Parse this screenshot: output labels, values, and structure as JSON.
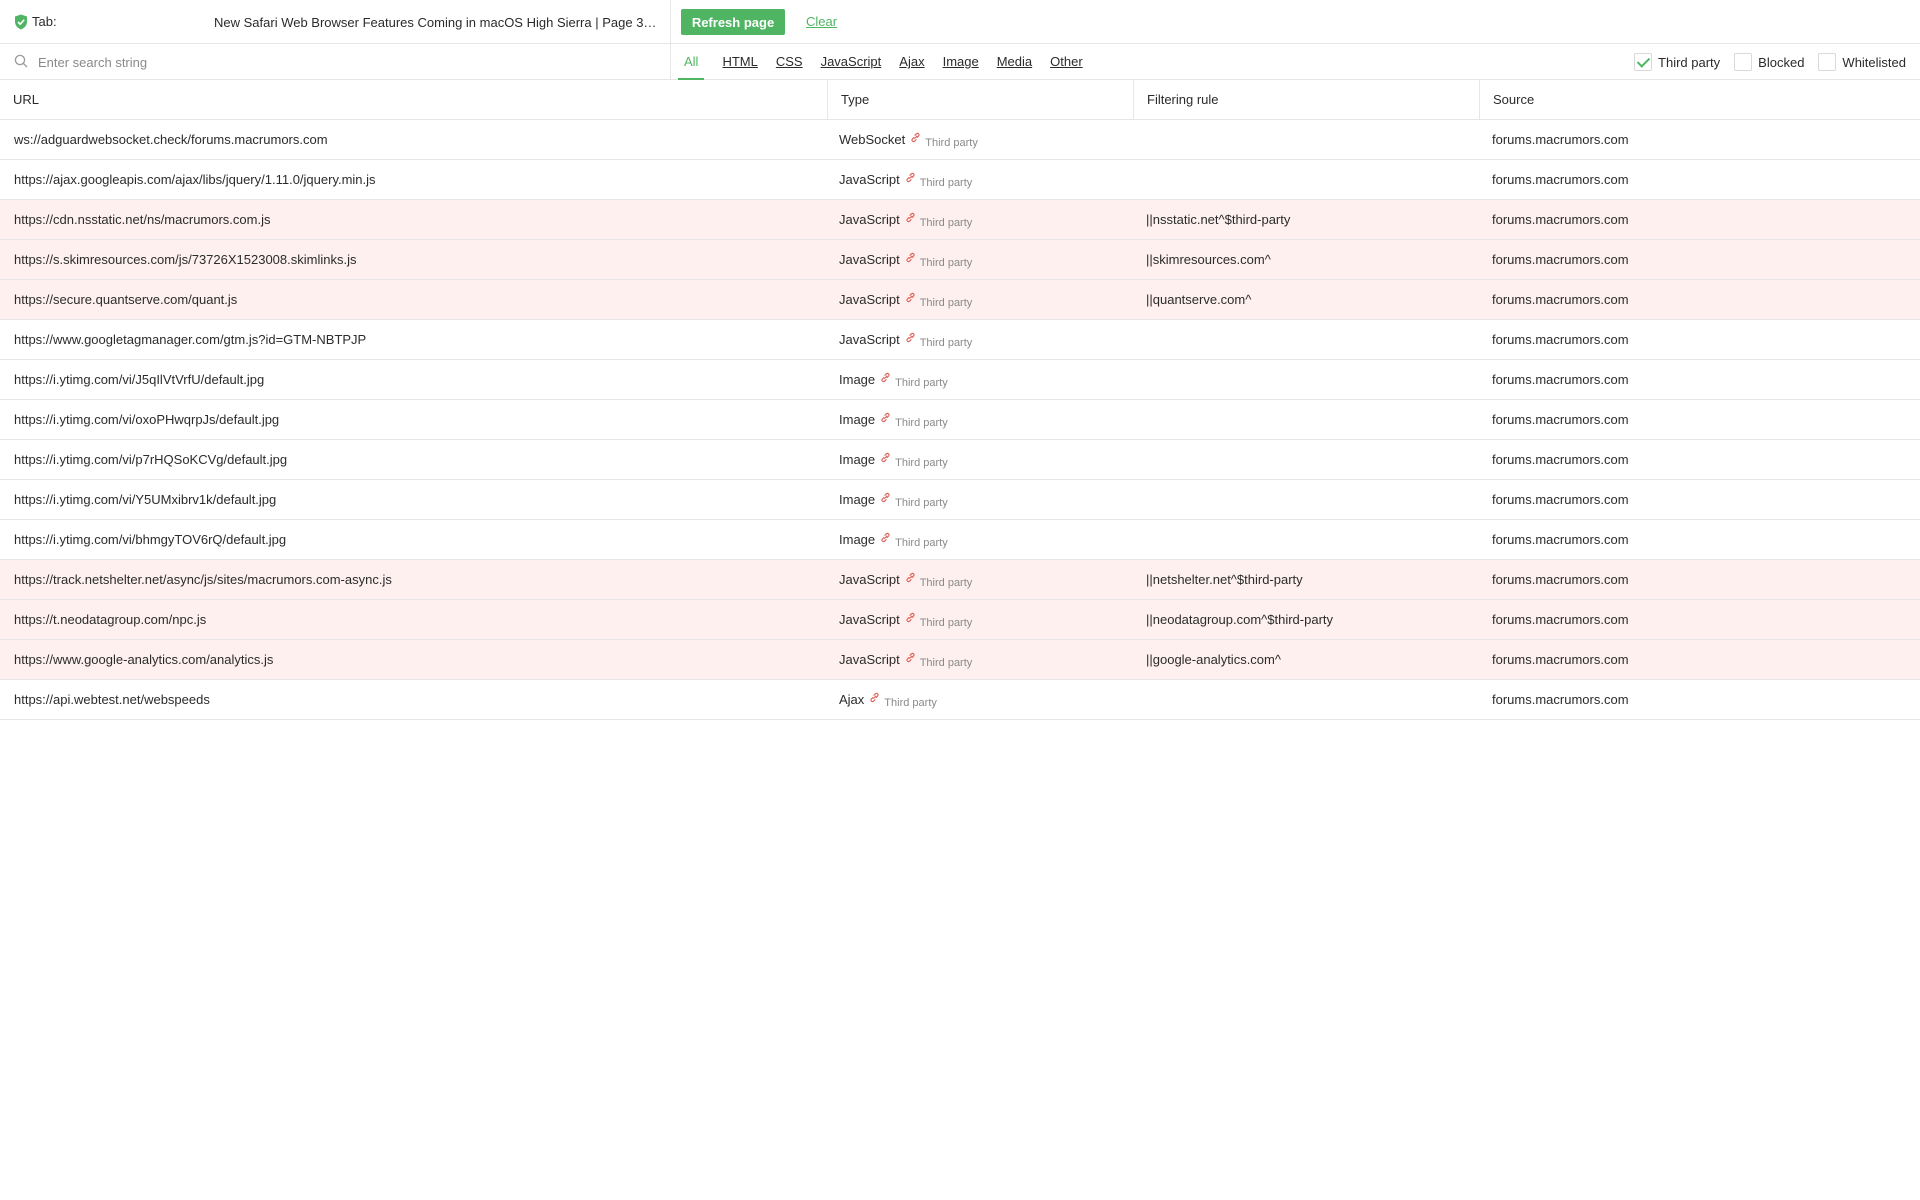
{
  "topbar": {
    "tab_label": "Tab:",
    "tab_title": "New Safari Web Browser Features Coming in macOS High Sierra | Page 3 | MacRumors Forums",
    "refresh_label": "Refresh page",
    "clear_label": "Clear"
  },
  "filter": {
    "search_placeholder": "Enter search string",
    "type_tabs": [
      "All",
      "HTML",
      "CSS",
      "JavaScript",
      "Ajax",
      "Image",
      "Media",
      "Other"
    ],
    "active_tab": "All",
    "checkboxes": [
      {
        "label": "Third party",
        "checked": true
      },
      {
        "label": "Blocked",
        "checked": false
      },
      {
        "label": "Whitelisted",
        "checked": false
      }
    ]
  },
  "table": {
    "headers": [
      "URL",
      "Type",
      "Filtering rule",
      "Source"
    ],
    "third_party_label": "Third party",
    "rows": [
      {
        "url": "ws://adguardwebsocket.check/forums.macrumors.com",
        "type": "WebSocket",
        "rule": "",
        "source": "forums.macrumors.com",
        "blocked": false
      },
      {
        "url": "https://ajax.googleapis.com/ajax/libs/jquery/1.11.0/jquery.min.js",
        "type": "JavaScript",
        "rule": "",
        "source": "forums.macrumors.com",
        "blocked": false
      },
      {
        "url": "https://cdn.nsstatic.net/ns/macrumors.com.js",
        "type": "JavaScript",
        "rule": "||nsstatic.net^$third-party",
        "source": "forums.macrumors.com",
        "blocked": true
      },
      {
        "url": "https://s.skimresources.com/js/73726X1523008.skimlinks.js",
        "type": "JavaScript",
        "rule": "||skimresources.com^",
        "source": "forums.macrumors.com",
        "blocked": true
      },
      {
        "url": "https://secure.quantserve.com/quant.js",
        "type": "JavaScript",
        "rule": "||quantserve.com^",
        "source": "forums.macrumors.com",
        "blocked": true
      },
      {
        "url": "https://www.googletagmanager.com/gtm.js?id=GTM-NBTPJP",
        "type": "JavaScript",
        "rule": "",
        "source": "forums.macrumors.com",
        "blocked": false
      },
      {
        "url": "https://i.ytimg.com/vi/J5qIlVtVrfU/default.jpg",
        "type": "Image",
        "rule": "",
        "source": "forums.macrumors.com",
        "blocked": false
      },
      {
        "url": "https://i.ytimg.com/vi/oxoPHwqrpJs/default.jpg",
        "type": "Image",
        "rule": "",
        "source": "forums.macrumors.com",
        "blocked": false
      },
      {
        "url": "https://i.ytimg.com/vi/p7rHQSoKCVg/default.jpg",
        "type": "Image",
        "rule": "",
        "source": "forums.macrumors.com",
        "blocked": false
      },
      {
        "url": "https://i.ytimg.com/vi/Y5UMxibrv1k/default.jpg",
        "type": "Image",
        "rule": "",
        "source": "forums.macrumors.com",
        "blocked": false
      },
      {
        "url": "https://i.ytimg.com/vi/bhmgyTOV6rQ/default.jpg",
        "type": "Image",
        "rule": "",
        "source": "forums.macrumors.com",
        "blocked": false
      },
      {
        "url": "https://track.netshelter.net/async/js/sites/macrumors.com-async.js",
        "type": "JavaScript",
        "rule": "||netshelter.net^$third-party",
        "source": "forums.macrumors.com",
        "blocked": true
      },
      {
        "url": "https://t.neodatagroup.com/npc.js",
        "type": "JavaScript",
        "rule": "||neodatagroup.com^$third-party",
        "source": "forums.macrumors.com",
        "blocked": true
      },
      {
        "url": "https://www.google-analytics.com/analytics.js",
        "type": "JavaScript",
        "rule": "||google-analytics.com^",
        "source": "forums.macrumors.com",
        "blocked": true
      },
      {
        "url": "https://api.webtest.net/webspeeds",
        "type": "Ajax",
        "rule": "",
        "source": "forums.macrumors.com",
        "blocked": false
      }
    ]
  },
  "colors": {
    "accent": "#4fb563",
    "blocked_row": "#fdf0ef",
    "link_icon": "#e0605a"
  },
  "icons": {
    "shield": "shield-icon",
    "search": "search-icon",
    "third_party": "link-icon"
  }
}
